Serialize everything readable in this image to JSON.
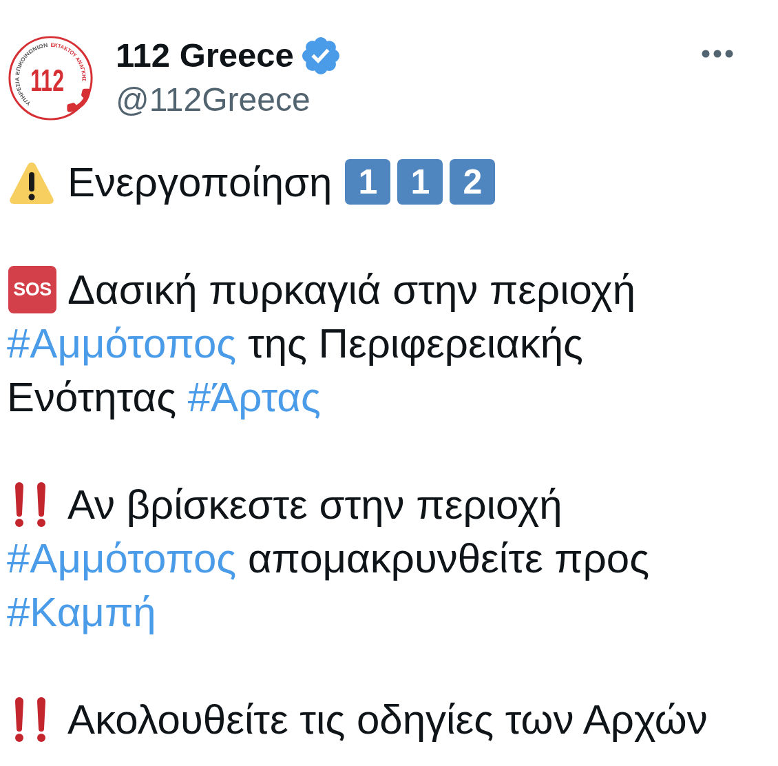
{
  "account": {
    "logo": {
      "ring_text_left": "ΥΠΗΡΕΣΙΑ ΕΠΙΚΟΙΝΩΝΙΩΝ",
      "ring_text_right": "ΕΚΤΑΚΤΟΥ ΑΝΑΓΚΗΣ",
      "number": "112"
    },
    "name": "112 Greece",
    "verified": true,
    "handle": "@112Greece"
  },
  "tweet": {
    "paragraphs": [
      {
        "parts": [
          {
            "kind": "warning"
          },
          {
            "kind": "text",
            "text": "Ενεργοποίηση"
          },
          {
            "kind": "keycap",
            "text": "1"
          },
          {
            "kind": "keycap",
            "text": "1"
          },
          {
            "kind": "keycap",
            "text": "2"
          }
        ]
      },
      {
        "parts": [
          {
            "kind": "sos",
            "text": "SOS"
          },
          {
            "kind": "text",
            "text": "Δασική πυρκαγιά στην περιοχή "
          },
          {
            "kind": "hashtag",
            "text": "#Αμμότοπος"
          },
          {
            "kind": "text",
            "text": " της Περιφερειακής Ενότητας "
          },
          {
            "kind": "hashtag",
            "text": "#Άρτας"
          }
        ]
      },
      {
        "parts": [
          {
            "kind": "double_exclamation"
          },
          {
            "kind": "text",
            "text": "Αν βρίσκεστε στην περιοχή "
          },
          {
            "kind": "hashtag",
            "text": "#Αμμότοπος"
          },
          {
            "kind": "text",
            "text": " απομακρυνθείτε προς "
          },
          {
            "kind": "hashtag",
            "text": "#Καμπή"
          }
        ]
      },
      {
        "parts": [
          {
            "kind": "double_exclamation"
          },
          {
            "kind": "text",
            "text": "Ακολουθείτε τις οδηγίες των Αρχών"
          }
        ]
      }
    ]
  }
}
